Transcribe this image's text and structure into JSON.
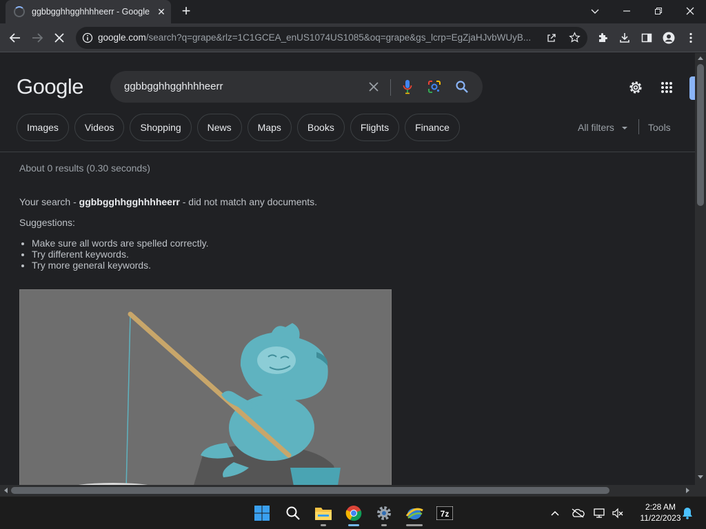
{
  "browser": {
    "tab_title": "ggbbgghhgghhhheerr - Google Search",
    "url_host": "google.com",
    "url_rest": "/search?q=grape&rlz=1C1GCEA_enUS1074US1085&oq=grape&gs_lcrp=EgZjaHJvbWUyB..."
  },
  "search": {
    "logo": "Google",
    "query": "ggbbgghhgghhhheerr"
  },
  "chips": [
    "Images",
    "Videos",
    "Shopping",
    "News",
    "Maps",
    "Books",
    "Flights",
    "Finance"
  ],
  "filters": {
    "all_filters": "All filters",
    "tools": "Tools"
  },
  "results": {
    "stats": "About 0 results (0.30 seconds)",
    "nomatch_prefix": "Your search - ",
    "nomatch_query": "ggbbgghhgghhhheerr",
    "nomatch_suffix": " - did not match any documents.",
    "suggestions_heading": "Suggestions:",
    "suggestions": [
      "Make sure all words are spelled correctly.",
      "Try different keywords.",
      "Try more general keywords."
    ]
  },
  "taskbar": {
    "time": "2:28 AM",
    "date": "11/22/2023",
    "apps": [
      "start-icon",
      "search-icon",
      "file-explorer-icon",
      "chrome-icon",
      "settings-icon",
      "network-app-icon",
      "7zip-icon"
    ]
  },
  "colors": {
    "page_bg": "#202124",
    "toolbar_bg": "#35363a",
    "accent_blue": "#8ab4f8",
    "illustration_bg": "#6e6e6e",
    "mascot": "#5fb3c0"
  }
}
